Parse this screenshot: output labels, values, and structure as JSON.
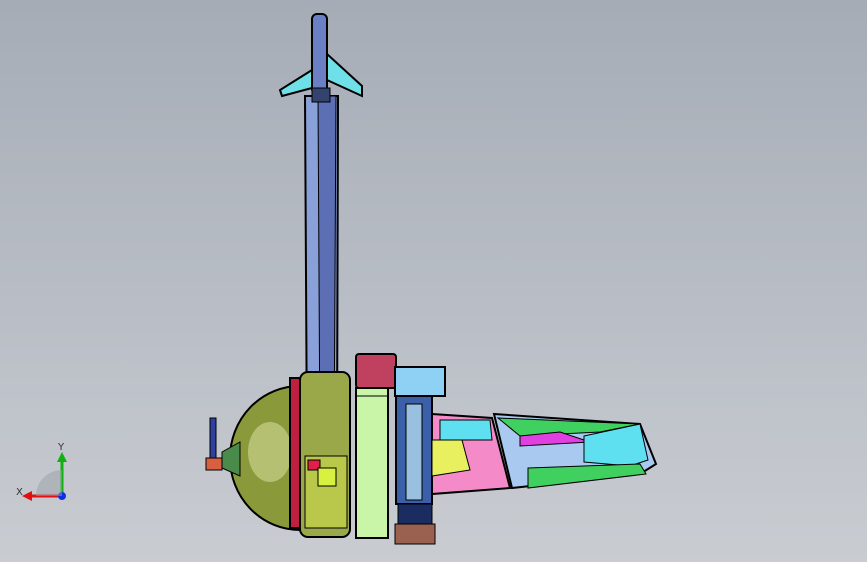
{
  "viewport": {
    "background_top": "#a6acb6",
    "background_bottom": "#c9ccd1"
  },
  "triad": {
    "x_label": "X",
    "y_label": "Y",
    "x_color": "#e01010",
    "y_color": "#10b010",
    "z_color": "#1030e0"
  },
  "colors": {
    "tower": "#8aa0d8",
    "tower_dark": "#5c6fb4",
    "fin": "#6fe0e8",
    "dome": "#9aa84a",
    "panel_green": "#c8f5a8",
    "body_blue": "#3b5fa8",
    "wing_cyan": "#5fe0f0",
    "wing_magenta": "#e040e0",
    "wing_pink": "#f58ac8",
    "wing_green": "#40d060",
    "wing_yellow": "#e8f060"
  }
}
